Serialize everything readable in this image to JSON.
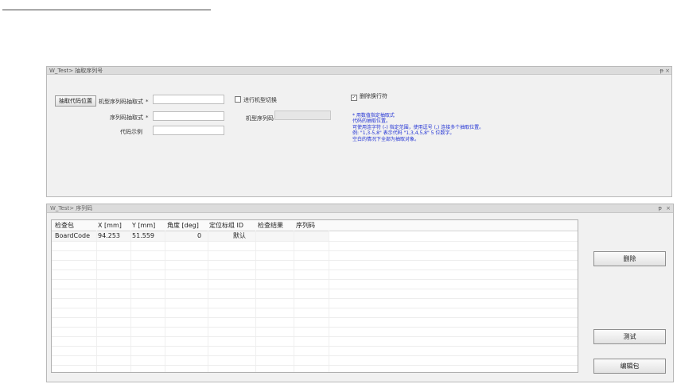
{
  "panel1": {
    "title": "W_Test> 抽取序列号",
    "pin": "ᵽ",
    "close": "×",
    "extract_button": "抽取代码位置",
    "model_serial_label": "机型序列码抽取式",
    "model_serial_value": "",
    "serial_label": "序列码抽取式",
    "serial_value": "",
    "code_example_label": "代码示例",
    "code_example_value": "",
    "required_mark": "*",
    "model_switch_check": "进行机型切换",
    "model_switch_checked": false,
    "model_serial_code_label": "机型序列码",
    "model_serial_code_value": "",
    "delete_line_check": "删除换行符",
    "delete_line_checked": true,
    "help": {
      "l1": "* 用数值指定抽取式",
      "l2": "代码的抽取位置。",
      "l3": "可使用连字符 (-) 指定范围，使用逗号 (,) 连接多个抽取位置。",
      "l4": "例: \"1,3-5,8\" 表示代码 \"1,3,4,5,8\" 5 位数字。",
      "l5": "空白的情况下全部为抽取对象。"
    }
  },
  "panel2": {
    "title": "W_Test> 序列码",
    "pin": "ᵽ",
    "close": "×",
    "columns": [
      "检查包",
      "X [mm]",
      "Y [mm]",
      "角度 [deg]",
      "定位标组 ID",
      "检查结果",
      "序列码"
    ],
    "rows": [
      {
        "package": "BoardCode",
        "x": "94.253",
        "y": "51.559",
        "angle": "0",
        "group": "默认",
        "result": "",
        "serial": ""
      }
    ],
    "delete_button": "删除",
    "test_button": "测试",
    "edit_button": "编辑包"
  }
}
